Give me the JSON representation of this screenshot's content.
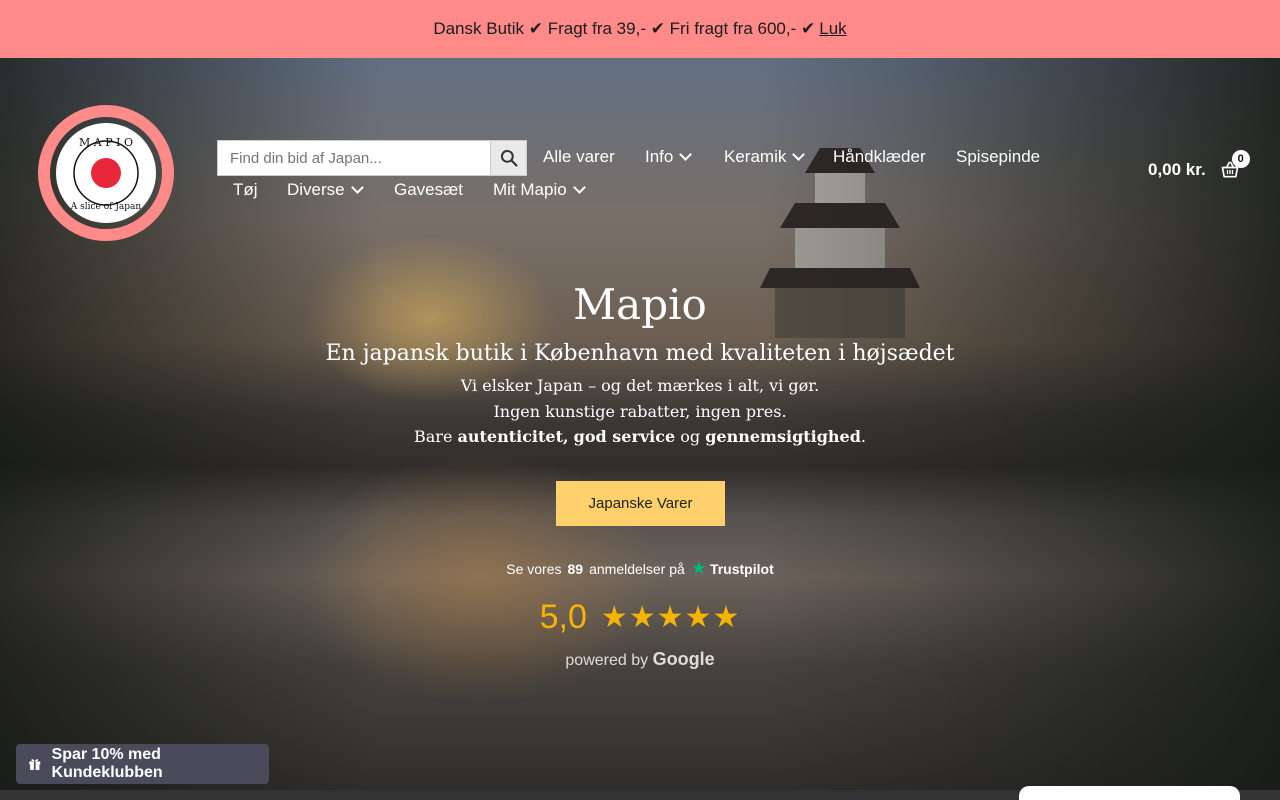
{
  "announcement": {
    "text": "Dansk Butik ✔ Fragt fra 39,- ✔ Fri fragt fra 600,- ✔",
    "close_link": "Luk",
    "bg_color": "#ff8a8a"
  },
  "logo": {
    "brand_letters": "M A P I O",
    "tagline": "A slice of Japan",
    "ring_color": "#ff8a8a",
    "dot_color": "#e8283a"
  },
  "search": {
    "placeholder": "Find din bid af Japan...",
    "icon": "search-icon"
  },
  "nav": {
    "items": [
      {
        "label": "Alle varer",
        "has_dropdown": false
      },
      {
        "label": "Info",
        "has_dropdown": true
      },
      {
        "label": "Keramik",
        "has_dropdown": true
      },
      {
        "label": "Håndklæder",
        "has_dropdown": false
      },
      {
        "label": "Spisepinde",
        "has_dropdown": false
      },
      {
        "label": "Tøj",
        "has_dropdown": false
      },
      {
        "label": "Diverse",
        "has_dropdown": true
      },
      {
        "label": "Gavesæt",
        "has_dropdown": false
      },
      {
        "label": "Mit Mapio",
        "has_dropdown": true
      }
    ]
  },
  "cart": {
    "total": "0,00 kr.",
    "count": "0",
    "icon": "basket-icon"
  },
  "hero": {
    "title": "Mapio",
    "subtitle": "En japansk butik i København med kvaliteten i højsædet",
    "line1": "Vi elsker Japan – og det mærkes i alt, vi gør.",
    "line2": "Ingen kunstige rabatter, ingen pres.",
    "line3_prefix": "Bare",
    "line3_bold1": "autenticitet",
    "line3_sep1": ",",
    "line3_bold2": "god service",
    "line3_mid": "og",
    "line3_bold3": "gennemsigtighed",
    "line3_end": ".",
    "cta_label": "Japanske Varer",
    "cta_color": "#ffd06b"
  },
  "trustpilot": {
    "prefix": "Se vores",
    "count": "89",
    "suffix": "anmeldelser på",
    "brand": "Trustpilot",
    "star_color": "#00b67a"
  },
  "google_rating": {
    "score": "5,0",
    "stars": "★★★★★",
    "powered_prefix": "powered by",
    "powered_brand": "Google",
    "color": "#f5b400"
  },
  "club_button": {
    "label": "Spar 10% med Kundeklubben",
    "icon": "gift-icon"
  }
}
